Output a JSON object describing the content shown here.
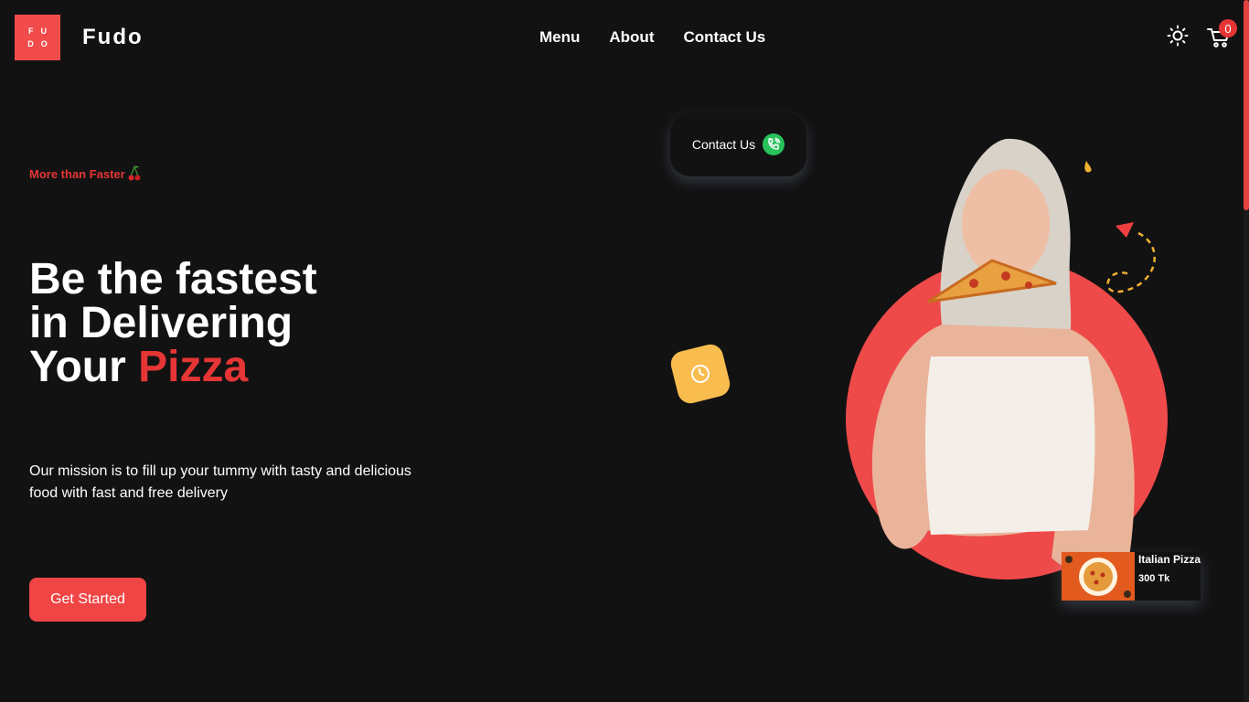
{
  "logo": {
    "letters_top": "FU",
    "letters_bottom": "DO"
  },
  "brand": "Fudo",
  "nav": [
    {
      "label": "Menu"
    },
    {
      "label": "About"
    },
    {
      "label": "Contact Us"
    }
  ],
  "cart": {
    "count": "0"
  },
  "hero": {
    "tagline": "More than Faster",
    "headline_line1": "Be the fastest",
    "headline_line2": "in Delivering",
    "headline_line3_prefix": "Your",
    "headline_line3_highlight": "Pizza",
    "mission": "Our mission is to fill up your tummy with tasty and delicious food with fast and free delivery",
    "cta_label": "Get Started"
  },
  "contact_pill": {
    "label": "Contact Us"
  },
  "product_card": {
    "name": "Italian Pizza",
    "price": "300 Tk"
  },
  "icons": [
    "sun-icon",
    "cart-icon",
    "cherry-icon",
    "phone-icon",
    "clock-icon"
  ],
  "colors": {
    "background": "#121213",
    "accent": "#e53535",
    "button": "#f04545",
    "yellow": "#f9bd4f",
    "green": "#27c25a"
  }
}
